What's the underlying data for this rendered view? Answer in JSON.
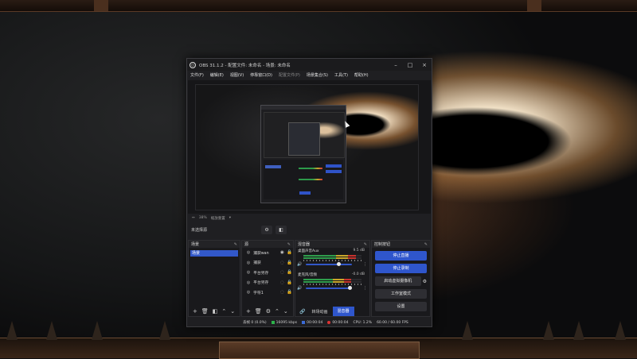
{
  "window": {
    "title": "OBS 31.1.2 - 配置文件: 未命名 - 场景: 未命名",
    "minimize": "–",
    "maximize": "□",
    "close": "×"
  },
  "menu": [
    "文件(F)",
    "编辑(E)",
    "视图(V)",
    "停靠窗口(D)",
    "配置文件(P)",
    "场景集合(S)",
    "工具(T)",
    "帮助(H)"
  ],
  "preview_toolbar": {
    "zoom": "38%",
    "reset": "缩放重置"
  },
  "scene_bar": {
    "label": "未选择源"
  },
  "scenes_dock": {
    "title": "场景",
    "items": [
      "场景"
    ]
  },
  "sources_dock": {
    "title": "源",
    "items": [
      {
        "icon": "game-capture-icon",
        "name": "捕获wan"
      },
      {
        "icon": "game-capture-icon",
        "name": "捕获"
      },
      {
        "icon": "game-capture-icon",
        "name": "平台另存"
      },
      {
        "icon": "game-capture-icon",
        "name": "平台另存"
      },
      {
        "icon": "game-capture-icon",
        "name": "字符1"
      }
    ]
  },
  "mixer_dock": {
    "title": "混音器",
    "channels": [
      {
        "name": "桌面声音Aux",
        "db": "9.5 dB",
        "level": 0.9,
        "volume": 0.72
      },
      {
        "name": "麦克风/音频",
        "db": "-0.0 dB",
        "level": 0.82,
        "volume": 0.95
      }
    ],
    "tab_transitions": "转场动画",
    "tab_mixer": "混音器"
  },
  "controls_dock": {
    "title": "控制按钮",
    "stop_stream": "停止直播",
    "stop_record": "停止录制",
    "virtual_cam": "启动虚拟摄像机",
    "studio_mode": "工作室模式",
    "settings": "设置"
  },
  "status": {
    "dropped": "丢帧 0 (0.0%)",
    "bitrate": "16095 kbps",
    "stream_time": "00:00:04",
    "record_time": "00:00:04",
    "cpu": "CPU: 1.2%",
    "fps": "60.00 / 60.00 FPS"
  },
  "colors": {
    "accent_blue": "#2f56cc",
    "meter_green": "#2f9d4c",
    "meter_yellow": "#c9a62a",
    "meter_red": "#c8332e"
  }
}
